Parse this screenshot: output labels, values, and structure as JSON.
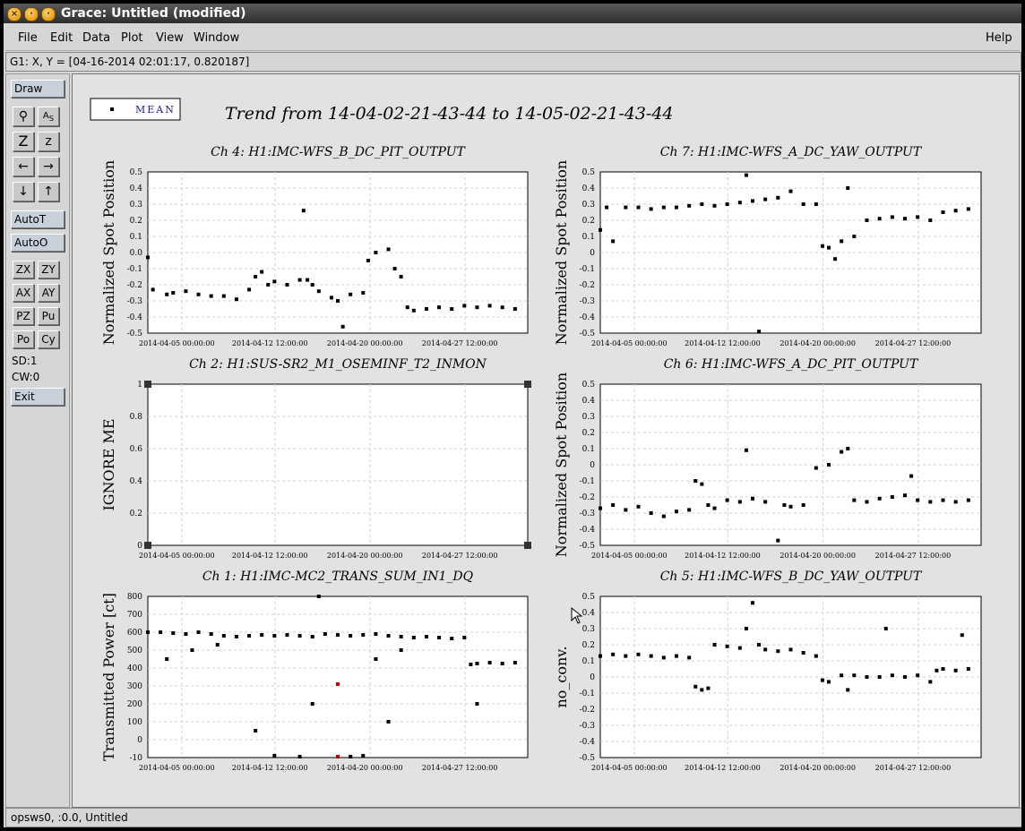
{
  "window": {
    "title": "Grace: Untitled (modified)"
  },
  "menu": {
    "file": "File",
    "edit": "Edit",
    "data": "Data",
    "plot": "Plot",
    "view": "View",
    "window": "Window",
    "help": "Help"
  },
  "coords_readout": "G1: X, Y = [04-16-2014 02:01:17, 0.820187]",
  "toolbar": {
    "draw": "Draw",
    "autot": "AutoT",
    "autoo": "AutoO",
    "zx": "ZX",
    "zy": "ZY",
    "ax": "AX",
    "ay": "AY",
    "pz": "PZ",
    "pu": "Pu",
    "po": "Po",
    "cy": "Cy",
    "sd": "SD:1",
    "cw": "CW:0",
    "exit": "Exit",
    "icons": [
      "zoom-icon",
      "autoscale-text-icon",
      "zoom-in-icon",
      "zoom-out-icon",
      "left-arrow-icon",
      "right-arrow-icon",
      "down-arrow-icon",
      "up-arrow-icon"
    ]
  },
  "legend": {
    "label": "MEAN"
  },
  "main_title": "Trend from 14-04-02-21-43-44 to 14-05-02-21-43-44",
  "status": "opsws0, :0.0, Untitled",
  "colors": {
    "red_point": "#cc0000",
    "points": "#000000"
  },
  "chart_data": [
    {
      "type": "scatter",
      "title": "Ch 4: H1:IMC-WFS_B_DC_PIT_OUTPUT",
      "ylabel": "Normalized Spot Position",
      "ylim": [
        -0.5,
        0.5
      ],
      "yticks": [
        "0.5",
        "0.4",
        "0.3",
        "0.2",
        "0.1",
        "0.0",
        "-0.1",
        "-0.2",
        "-0.3",
        "-0.4",
        "-0.5"
      ],
      "xticks": [
        "2014-04-05 00:00:00",
        "2014-04-12 12:00:00",
        "2014-04-20 00:00:00",
        "2014-04-27 12:00:00"
      ],
      "series": [
        {
          "name": "MEAN",
          "points": [
            [
              0,
              -0.03
            ],
            [
              0.4,
              -0.23
            ],
            [
              1.5,
              -0.26
            ],
            [
              2,
              -0.25
            ],
            [
              3,
              -0.24
            ],
            [
              4,
              -0.26
            ],
            [
              5,
              -0.27
            ],
            [
              6,
              -0.27
            ],
            [
              7,
              -0.29
            ],
            [
              8,
              -0.23
            ],
            [
              8.5,
              -0.15
            ],
            [
              9,
              -0.12
            ],
            [
              9.5,
              -0.2
            ],
            [
              10,
              -0.18
            ],
            [
              11,
              -0.2
            ],
            [
              12,
              -0.17
            ],
            [
              12.3,
              0.26
            ],
            [
              12.6,
              -0.17
            ],
            [
              13,
              -0.2
            ],
            [
              13.5,
              -0.24
            ],
            [
              14.5,
              -0.28
            ],
            [
              15,
              -0.3
            ],
            [
              15.4,
              -0.46
            ],
            [
              16,
              -0.26
            ],
            [
              17,
              -0.25
            ],
            [
              17.4,
              -0.05
            ],
            [
              18,
              0
            ],
            [
              19,
              0.02
            ],
            [
              19.5,
              -0.1
            ],
            [
              20,
              -0.15
            ],
            [
              20.5,
              -0.34
            ],
            [
              21,
              -0.36
            ],
            [
              22,
              -0.35
            ],
            [
              23,
              -0.34
            ],
            [
              24,
              -0.35
            ],
            [
              25,
              -0.33
            ],
            [
              26,
              -0.34
            ],
            [
              27,
              -0.33
            ],
            [
              28,
              -0.34
            ],
            [
              29,
              -0.35
            ]
          ]
        }
      ]
    },
    {
      "type": "scatter",
      "title": "Ch 7: H1:IMC-WFS_A_DC_YAW_OUTPUT",
      "ylabel": "Normalized Spot Position",
      "ylim": [
        -0.5,
        0.5
      ],
      "yticks": [
        "0.5",
        "0.4",
        "0.3",
        "0.2",
        "0.1",
        "0",
        "-0.1",
        "-0.2",
        "-0.3",
        "-0.4",
        "-0.5"
      ],
      "xticks": [
        "2014-04-05 00:00:00",
        "2014-04-12 12:00:00",
        "2014-04-20 00:00:00",
        "2014-04-27 12:00:00"
      ],
      "series": [
        {
          "name": "MEAN",
          "points": [
            [
              0,
              0.14
            ],
            [
              0.5,
              0.28
            ],
            [
              1,
              0.07
            ],
            [
              2,
              0.28
            ],
            [
              3,
              0.28
            ],
            [
              4,
              0.27
            ],
            [
              5,
              0.28
            ],
            [
              6,
              0.28
            ],
            [
              7,
              0.29
            ],
            [
              8,
              0.3
            ],
            [
              9,
              0.29
            ],
            [
              10,
              0.3
            ],
            [
              11,
              0.31
            ],
            [
              11.5,
              0.48
            ],
            [
              12,
              0.32
            ],
            [
              12.5,
              -0.49
            ],
            [
              13,
              0.33
            ],
            [
              14,
              0.34
            ],
            [
              15,
              0.38
            ],
            [
              16,
              0.3
            ],
            [
              17,
              0.3
            ],
            [
              17.5,
              0.04
            ],
            [
              18,
              0.03
            ],
            [
              18.5,
              -0.04
            ],
            [
              19,
              0.07
            ],
            [
              19.5,
              0.4
            ],
            [
              20,
              0.1
            ],
            [
              21,
              0.2
            ],
            [
              22,
              0.21
            ],
            [
              23,
              0.22
            ],
            [
              24,
              0.21
            ],
            [
              25,
              0.22
            ],
            [
              26,
              0.2
            ],
            [
              27,
              0.25
            ],
            [
              28,
              0.26
            ],
            [
              29,
              0.27
            ]
          ]
        }
      ]
    },
    {
      "type": "scatter",
      "title": "Ch 2: H1:SUS-SR2_M1_OSEMINF_T2_INMON",
      "ylabel": "IGNORE ME",
      "ylim": [
        0,
        1
      ],
      "yticks": [
        "1",
        "0.8",
        "0.6",
        "0.4",
        "0.2",
        "0"
      ],
      "xticks": [
        "2014-04-05 00:00:00",
        "2014-04-12 12:00:00",
        "2014-04-20 00:00:00",
        "2014-04-27 12:00:00"
      ],
      "series": [
        {
          "name": "MEAN",
          "points": []
        }
      ]
    },
    {
      "type": "scatter",
      "title": "Ch 6: H1:IMC-WFS_A_DC_PIT_OUTPUT",
      "ylabel": "Normalized Spot Position",
      "ylim": [
        -0.5,
        0.5
      ],
      "yticks": [
        "0.5",
        "0.4",
        "0.3",
        "0.2",
        "0.1",
        "0",
        "-0.1",
        "-0.2",
        "-0.3",
        "-0.4",
        "-0.5"
      ],
      "xticks": [
        "2014-04-05 00:00:00",
        "2014-04-12 12:00:00",
        "2014-04-20 00:00:00",
        "2014-04-27 12:00:00"
      ],
      "series": [
        {
          "name": "MEAN",
          "points": [
            [
              0,
              -0.27
            ],
            [
              1,
              -0.25
            ],
            [
              2,
              -0.28
            ],
            [
              3,
              -0.26
            ],
            [
              4,
              -0.3
            ],
            [
              5,
              -0.32
            ],
            [
              6,
              -0.29
            ],
            [
              7,
              -0.28
            ],
            [
              7.5,
              -0.1
            ],
            [
              8,
              -0.12
            ],
            [
              8.5,
              -0.25
            ],
            [
              9,
              -0.27
            ],
            [
              10,
              -0.22
            ],
            [
              11,
              -0.23
            ],
            [
              11.5,
              0.09
            ],
            [
              12,
              -0.21
            ],
            [
              13,
              -0.23
            ],
            [
              14,
              -0.47
            ],
            [
              14.5,
              -0.25
            ],
            [
              15,
              -0.26
            ],
            [
              16,
              -0.25
            ],
            [
              17,
              -0.02
            ],
            [
              18,
              0
            ],
            [
              19,
              0.08
            ],
            [
              19.5,
              0.1
            ],
            [
              20,
              -0.22
            ],
            [
              21,
              -0.23
            ],
            [
              22,
              -0.21
            ],
            [
              23,
              -0.2
            ],
            [
              24,
              -0.19
            ],
            [
              24.5,
              -0.07
            ],
            [
              25,
              -0.22
            ],
            [
              26,
              -0.23
            ],
            [
              27,
              -0.22
            ],
            [
              28,
              -0.23
            ],
            [
              29,
              -0.22
            ]
          ]
        }
      ]
    },
    {
      "type": "scatter",
      "title": "Ch 1: H1:IMC-MC2_TRANS_SUM_IN1_DQ",
      "ylabel": "Transmitted Power [ct]",
      "ylim": [
        -100,
        800
      ],
      "yticks": [
        "800",
        "700",
        "600",
        "500",
        "400",
        "300",
        "200",
        "100",
        "0",
        "-10"
      ],
      "xticks": [
        "2014-04-05 00:00:00",
        "2014-04-12 12:00:00",
        "2014-04-20 00:00:00",
        "2014-04-27 12:00:00"
      ],
      "series": [
        {
          "name": "MEAN",
          "points": [
            [
              0,
              600
            ],
            [
              1,
              600
            ],
            [
              2,
              595
            ],
            [
              3,
              590
            ],
            [
              4,
              600
            ],
            [
              5,
              590
            ],
            [
              6,
              580
            ],
            [
              7,
              575
            ],
            [
              8,
              580
            ],
            [
              9,
              585
            ],
            [
              10,
              580
            ],
            [
              11,
              585
            ],
            [
              12,
              580
            ],
            [
              13,
              575
            ],
            [
              13.5,
              800
            ],
            [
              14,
              590
            ],
            [
              15,
              585
            ],
            [
              16,
              580
            ],
            [
              17,
              585
            ],
            [
              18,
              590
            ],
            [
              19,
              580
            ],
            [
              20,
              575
            ],
            [
              21,
              570
            ],
            [
              22,
              575
            ],
            [
              23,
              570
            ],
            [
              24,
              565
            ],
            [
              25,
              570
            ],
            [
              25.5,
              420
            ],
            [
              26,
              425
            ],
            [
              27,
              430
            ],
            [
              28,
              425
            ],
            [
              29,
              430
            ],
            [
              1.5,
              450
            ],
            [
              3.5,
              500
            ],
            [
              5.5,
              530
            ],
            [
              8.5,
              50
            ],
            [
              10,
              -90
            ],
            [
              12,
              -95
            ],
            [
              13,
              200
            ],
            [
              16,
              -95
            ],
            [
              17,
              -90
            ],
            [
              18,
              450
            ],
            [
              19,
              100
            ],
            [
              20,
              500
            ],
            [
              26,
              200
            ]
          ]
        },
        {
          "name": "red",
          "points": [
            [
              15,
              310
            ],
            [
              15,
              -95
            ]
          ]
        }
      ]
    },
    {
      "type": "scatter",
      "title": "Ch 5: H1:IMC-WFS_B_DC_YAW_OUTPUT",
      "ylabel": "no_conv.",
      "ylim": [
        -0.5,
        0.5
      ],
      "yticks": [
        "0.5",
        "0.4",
        "0.3",
        "0.2",
        "0.1",
        "0",
        "-0.1",
        "-0.2",
        "-0.3",
        "-0.4",
        "-0.5"
      ],
      "xticks": [
        "2014-04-05 00:00:00",
        "2014-04-12 12:00:00",
        "2014-04-20 00:00:00",
        "2014-04-27 12:00:00"
      ],
      "series": [
        {
          "name": "MEAN",
          "points": [
            [
              0,
              0.13
            ],
            [
              1,
              0.14
            ],
            [
              2,
              0.13
            ],
            [
              3,
              0.14
            ],
            [
              4,
              0.13
            ],
            [
              5,
              0.12
            ],
            [
              6,
              0.13
            ],
            [
              7,
              0.12
            ],
            [
              7.5,
              -0.06
            ],
            [
              8,
              -0.08
            ],
            [
              8.5,
              -0.07
            ],
            [
              9,
              0.2
            ],
            [
              10,
              0.19
            ],
            [
              11,
              0.18
            ],
            [
              11.5,
              0.3
            ],
            [
              12,
              0.46
            ],
            [
              12.5,
              0.2
            ],
            [
              13,
              0.17
            ],
            [
              14,
              0.16
            ],
            [
              15,
              0.17
            ],
            [
              16,
              0.15
            ],
            [
              17,
              0.13
            ],
            [
              17.5,
              -0.02
            ],
            [
              18,
              -0.03
            ],
            [
              19,
              0.01
            ],
            [
              19.5,
              -0.08
            ],
            [
              20,
              0.01
            ],
            [
              21,
              0
            ],
            [
              22,
              0
            ],
            [
              22.5,
              0.3
            ],
            [
              23,
              0.01
            ],
            [
              24,
              0
            ],
            [
              25,
              0.01
            ],
            [
              26,
              -0.03
            ],
            [
              26.5,
              0.04
            ],
            [
              27,
              0.05
            ],
            [
              28,
              0.04
            ],
            [
              28.5,
              0.26
            ],
            [
              29,
              0.05
            ]
          ]
        }
      ]
    }
  ]
}
